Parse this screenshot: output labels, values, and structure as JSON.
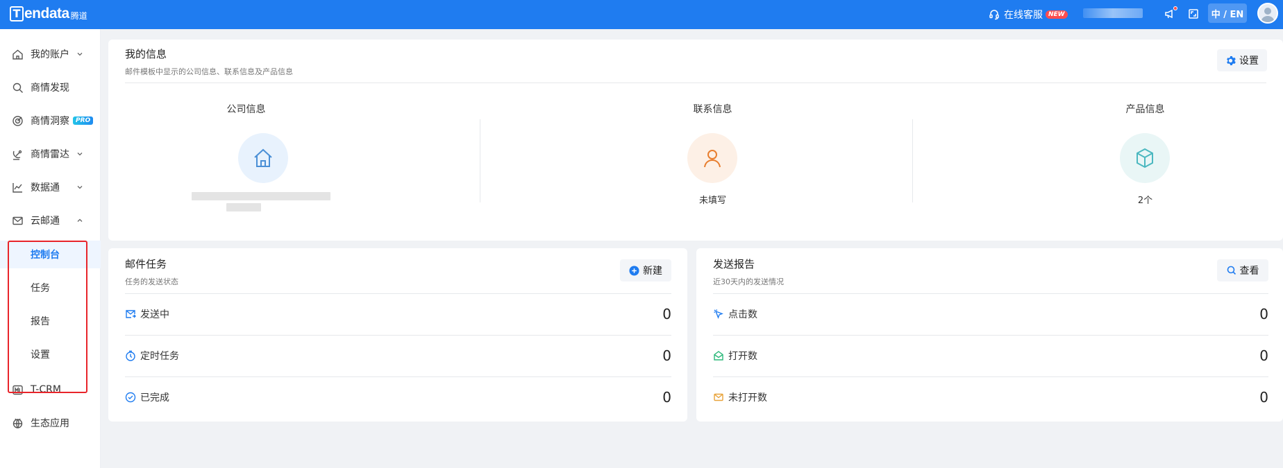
{
  "topbar": {
    "logo_word": "endata",
    "logo_letter": "T",
    "logo_cn": "腾道",
    "support_label": "在线客服",
    "support_badge": "NEW",
    "lang_label": "中 / EN",
    "icons": [
      "headset-icon",
      "megaphone-icon",
      "fullscreen-icon",
      "avatar"
    ]
  },
  "sidebar": {
    "items": [
      {
        "label": "我的账户",
        "icon": "home-icon",
        "has_chevron": true
      },
      {
        "label": "商情发现",
        "icon": "search-icon",
        "has_chevron": false
      },
      {
        "label": "商情洞察",
        "icon": "target-icon",
        "badge": "PRO"
      },
      {
        "label": "商情雷达",
        "icon": "radar-icon",
        "has_chevron": true
      },
      {
        "label": "数据通",
        "icon": "chart-line-icon",
        "has_chevron": true
      },
      {
        "label": "云邮通",
        "icon": "mail-icon",
        "expanded": true
      },
      {
        "label": "T-CRM",
        "icon": "crm-icon"
      },
      {
        "label": "生态应用",
        "icon": "globe-icon"
      }
    ],
    "subitems": [
      {
        "label": "控制台",
        "active": true
      },
      {
        "label": "任务",
        "active": false
      },
      {
        "label": "报告",
        "active": false
      },
      {
        "label": "设置",
        "active": false
      }
    ]
  },
  "my_info": {
    "title": "我的信息",
    "subtitle": "邮件模板中显示的公司信息、联系信息及产品信息",
    "settings_label": "设置",
    "columns": [
      {
        "title": "公司信息",
        "icon": "house-icon",
        "value": ""
      },
      {
        "title": "联系信息",
        "icon": "person-icon",
        "value": "未填写"
      },
      {
        "title": "产品信息",
        "icon": "box-icon",
        "value": "2个"
      }
    ]
  },
  "mail_tasks": {
    "title": "邮件任务",
    "subtitle": "任务的发送状态",
    "new_label": "新建",
    "rows": [
      {
        "label": "发送中",
        "value": "0",
        "icon": "mail-sending-icon"
      },
      {
        "label": "定时任务",
        "value": "0",
        "icon": "timer-icon"
      },
      {
        "label": "已完成",
        "value": "0",
        "icon": "check-circle-icon"
      }
    ]
  },
  "send_report": {
    "title": "发送报告",
    "subtitle": "近30天内的发送情况",
    "view_label": "查看",
    "rows": [
      {
        "label": "点击数",
        "value": "0",
        "icon": "cursor-click-icon"
      },
      {
        "label": "打开数",
        "value": "0",
        "icon": "mail-open-icon"
      },
      {
        "label": "未打开数",
        "value": "0",
        "icon": "mail-closed-icon"
      }
    ]
  },
  "colors": {
    "brand": "#1f7cf0",
    "highlight_box": "#e8242a",
    "page_bg": "#f0f2f5"
  }
}
